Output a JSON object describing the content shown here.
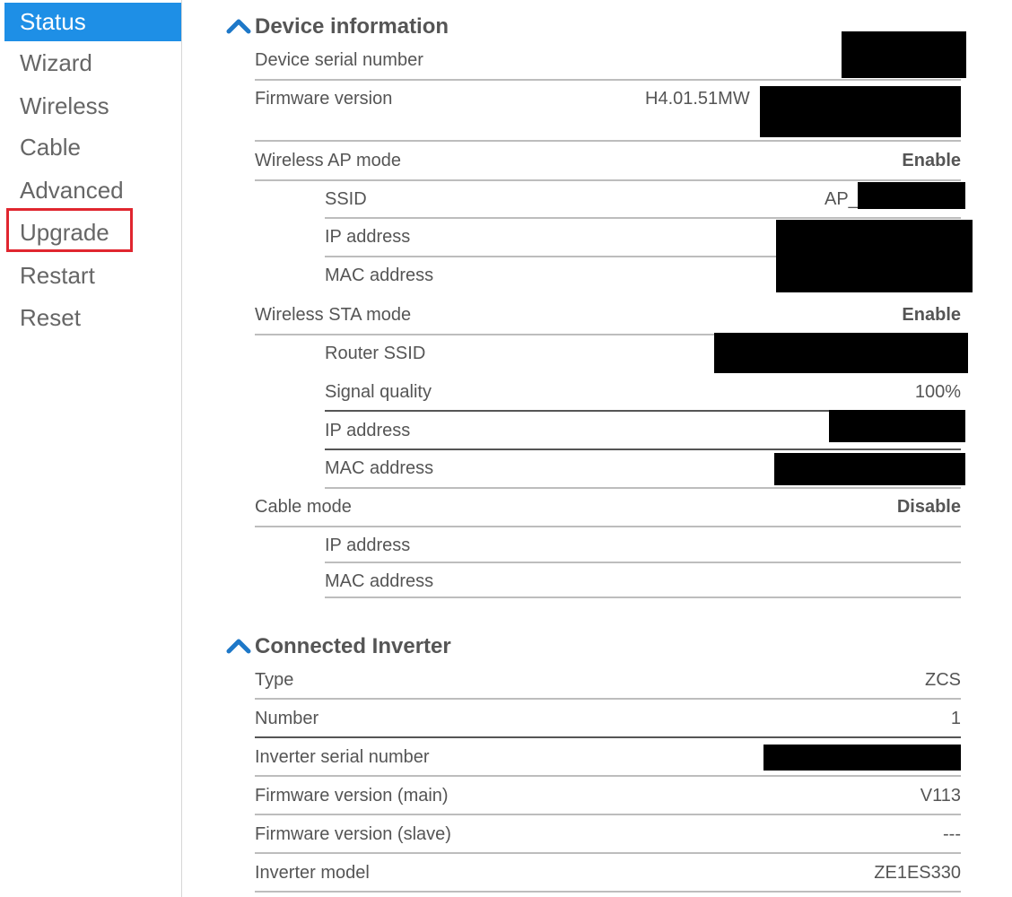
{
  "sidebar": {
    "items": [
      {
        "label": "Status"
      },
      {
        "label": "Wizard"
      },
      {
        "label": "Wireless"
      },
      {
        "label": "Cable"
      },
      {
        "label": "Advanced"
      },
      {
        "label": "Upgrade"
      },
      {
        "label": "Restart"
      },
      {
        "label": "Reset"
      }
    ],
    "active_color": "#1e8fe6",
    "highlight_color": "#e0262f"
  },
  "device_info": {
    "title": "Device information",
    "serial_label": "Device serial number",
    "firmware_label": "Firmware version",
    "firmware_value": "H4.01.51MW",
    "ap_mode_label": "Wireless AP mode",
    "ap_mode_value": "Enable",
    "ap_ssid_label": "SSID",
    "ap_ssid_value": "AP_",
    "ap_ip_label": "IP address",
    "ap_mac_label": "MAC address",
    "sta_mode_label": "Wireless STA mode",
    "sta_mode_value": "Enable",
    "router_ssid_label": "Router SSID",
    "signal_label": "Signal quality",
    "signal_value": "100%",
    "sta_ip_label": "IP address",
    "sta_mac_label": "MAC address",
    "cable_mode_label": "Cable mode",
    "cable_mode_value": "Disable",
    "cable_ip_label": "IP address",
    "cable_mac_label": "MAC address"
  },
  "inverter": {
    "title": "Connected Inverter",
    "type_label": "Type",
    "type_value": "ZCS",
    "number_label": "Number",
    "number_value": "1",
    "serial_label": "Inverter serial number",
    "fw_main_label": "Firmware version (main)",
    "fw_main_value": "V113",
    "fw_slave_label": "Firmware version (slave)",
    "fw_slave_value": "---",
    "model_label": "Inverter model",
    "model_value": "ZE1ES330"
  },
  "icons": {
    "section_toggle": "chevron-up-icon"
  }
}
